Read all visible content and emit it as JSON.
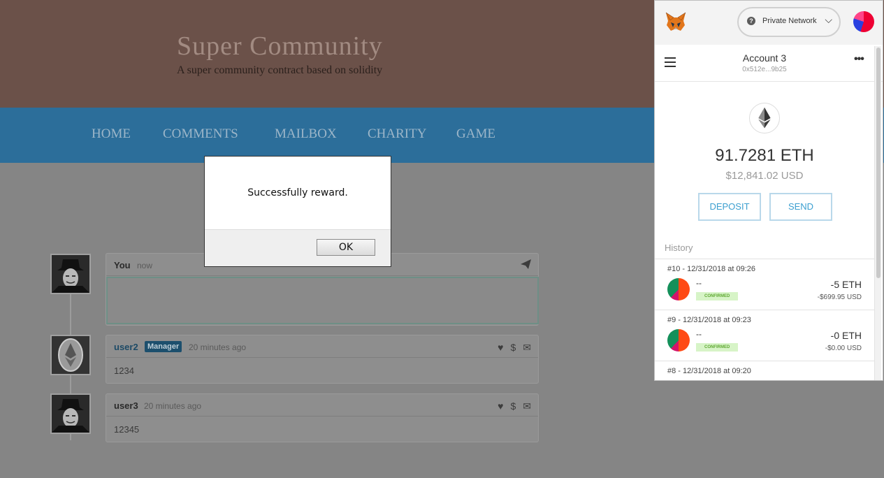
{
  "site": {
    "title": "Super Community",
    "subtitle": "A super community contract based on solidity",
    "nav": [
      "HOME",
      "COMMENTS",
      "MAILBOX",
      "CHARITY",
      "GAME"
    ]
  },
  "compose": {
    "author": "You",
    "time": "now"
  },
  "comments": [
    {
      "author": "user2",
      "badge": "Manager",
      "time": "20 minutes ago",
      "body": "1234"
    },
    {
      "author": "user3",
      "time": "20 minutes ago",
      "body": "12345"
    }
  ],
  "dialog": {
    "message": "Successfully reward.",
    "ok_label": "OK"
  },
  "metamask": {
    "network": "Private Network",
    "account_name": "Account 3",
    "account_address": "0x512e...9b25",
    "balance": "91.7281 ETH",
    "balance_usd": "$12,841.02 USD",
    "deposit_label": "DEPOSIT",
    "send_label": "SEND",
    "history_label": "History",
    "transactions": [
      {
        "date": "#10 - 12/31/2018 at 09:26",
        "name": "--",
        "status": "CONFIRMED",
        "amount": "-5 ETH",
        "usd": "-$699.95 USD"
      },
      {
        "date": "#9 - 12/31/2018 at 09:23",
        "name": "--",
        "status": "CONFIRMED",
        "amount": "-0 ETH",
        "usd": "-$0.00 USD"
      },
      {
        "date": "#8 - 12/31/2018 at 09:20"
      }
    ]
  }
}
